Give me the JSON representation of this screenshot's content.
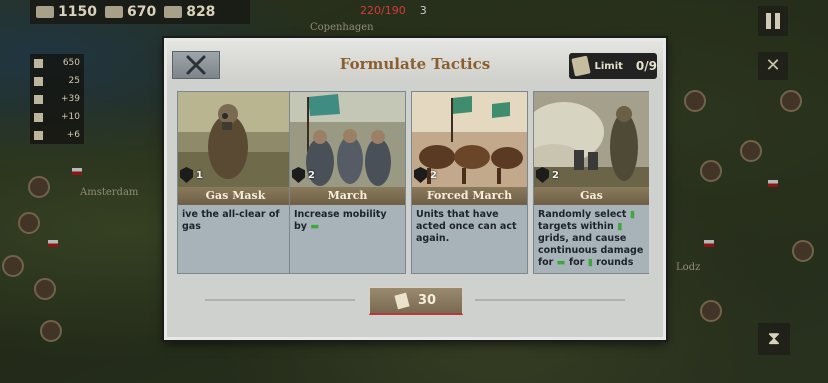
{
  "resources": [
    {
      "name": "gold-icon",
      "value": "1150"
    },
    {
      "name": "industry-icon",
      "value": "670"
    },
    {
      "name": "medal-icon",
      "value": "828"
    }
  ],
  "top_status": {
    "manpower": "220/190",
    "count": "3"
  },
  "left_stats": [
    "650",
    "25",
    "+39",
    "+10",
    "+6"
  ],
  "map_cities": [
    "Amsterdam",
    "Copenhagen",
    "Lodz"
  ],
  "dialog": {
    "title": "Formulate Tactics",
    "limit_label": "Limit",
    "limit_value": "0/9",
    "cost": "30"
  },
  "cards": [
    {
      "name": "Gas Mask",
      "level": "1",
      "desc_parts": [
        "ive the all-clear of gas"
      ]
    },
    {
      "name": "March",
      "level": "2",
      "desc_parts": [
        "Increase mobility by "
      ]
    },
    {
      "name": "Forced March",
      "level": "2",
      "desc_parts": [
        "Units that have acted once can act again."
      ]
    },
    {
      "name": "Gas",
      "level": "2",
      "desc_parts": [
        "Randomly select ",
        " targets within ",
        " grids, and cause continuous damage for ",
        " for ",
        " rounds"
      ]
    }
  ],
  "colors": {
    "title": "#8a5e2e",
    "highlight": "#3ea83e",
    "card_bg": "#a7b2b9",
    "name_bar": "#7a6a4e"
  }
}
